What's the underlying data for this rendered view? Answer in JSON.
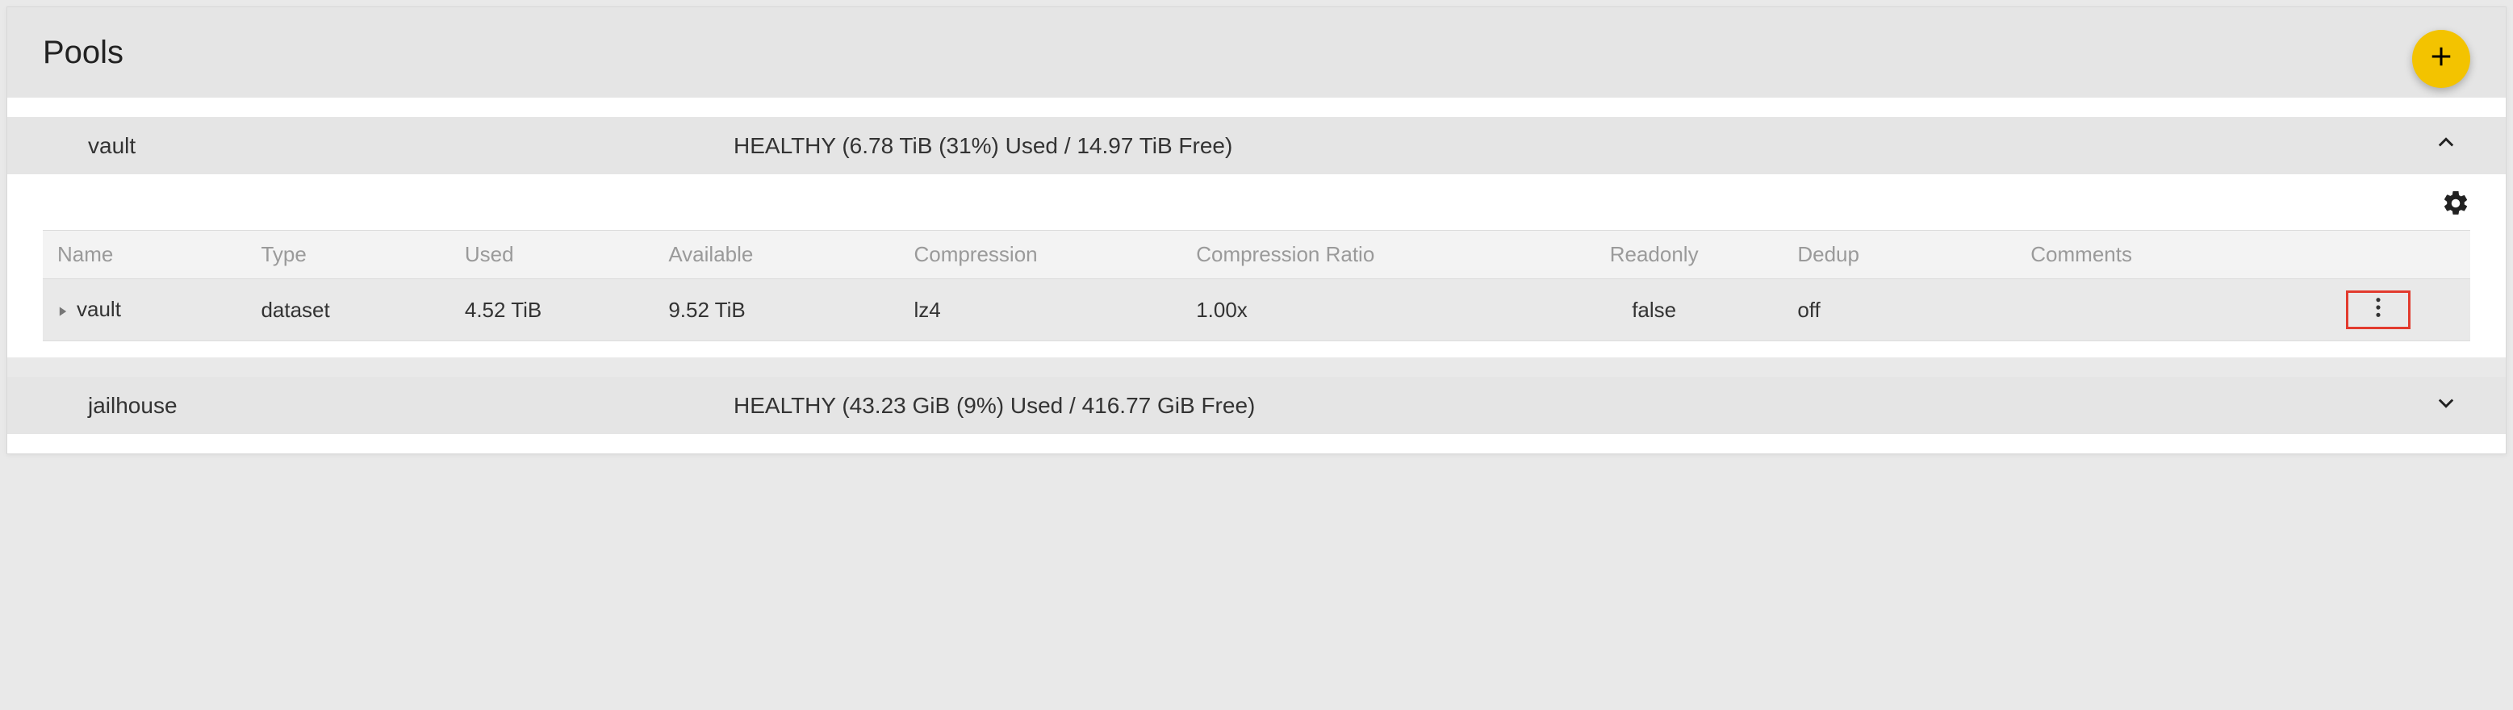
{
  "header": {
    "title": "Pools"
  },
  "pools": [
    {
      "name": "vault",
      "status": "HEALTHY (6.78 TiB (31%) Used / 14.97 TiB Free)",
      "expanded": true,
      "columns": {
        "name": "Name",
        "type": "Type",
        "used": "Used",
        "available": "Available",
        "compression": "Compression",
        "compression_ratio": "Compression Ratio",
        "readonly": "Readonly",
        "dedup": "Dedup",
        "comments": "Comments"
      },
      "rows": [
        {
          "name": "vault",
          "type": "dataset",
          "used": "4.52 TiB",
          "available": "9.52 TiB",
          "compression": "lz4",
          "compression_ratio": "1.00x",
          "readonly": "false",
          "dedup": "off",
          "comments": ""
        }
      ]
    },
    {
      "name": "jailhouse",
      "status": "HEALTHY (43.23 GiB (9%) Used / 416.77 GiB Free)",
      "expanded": false
    }
  ]
}
